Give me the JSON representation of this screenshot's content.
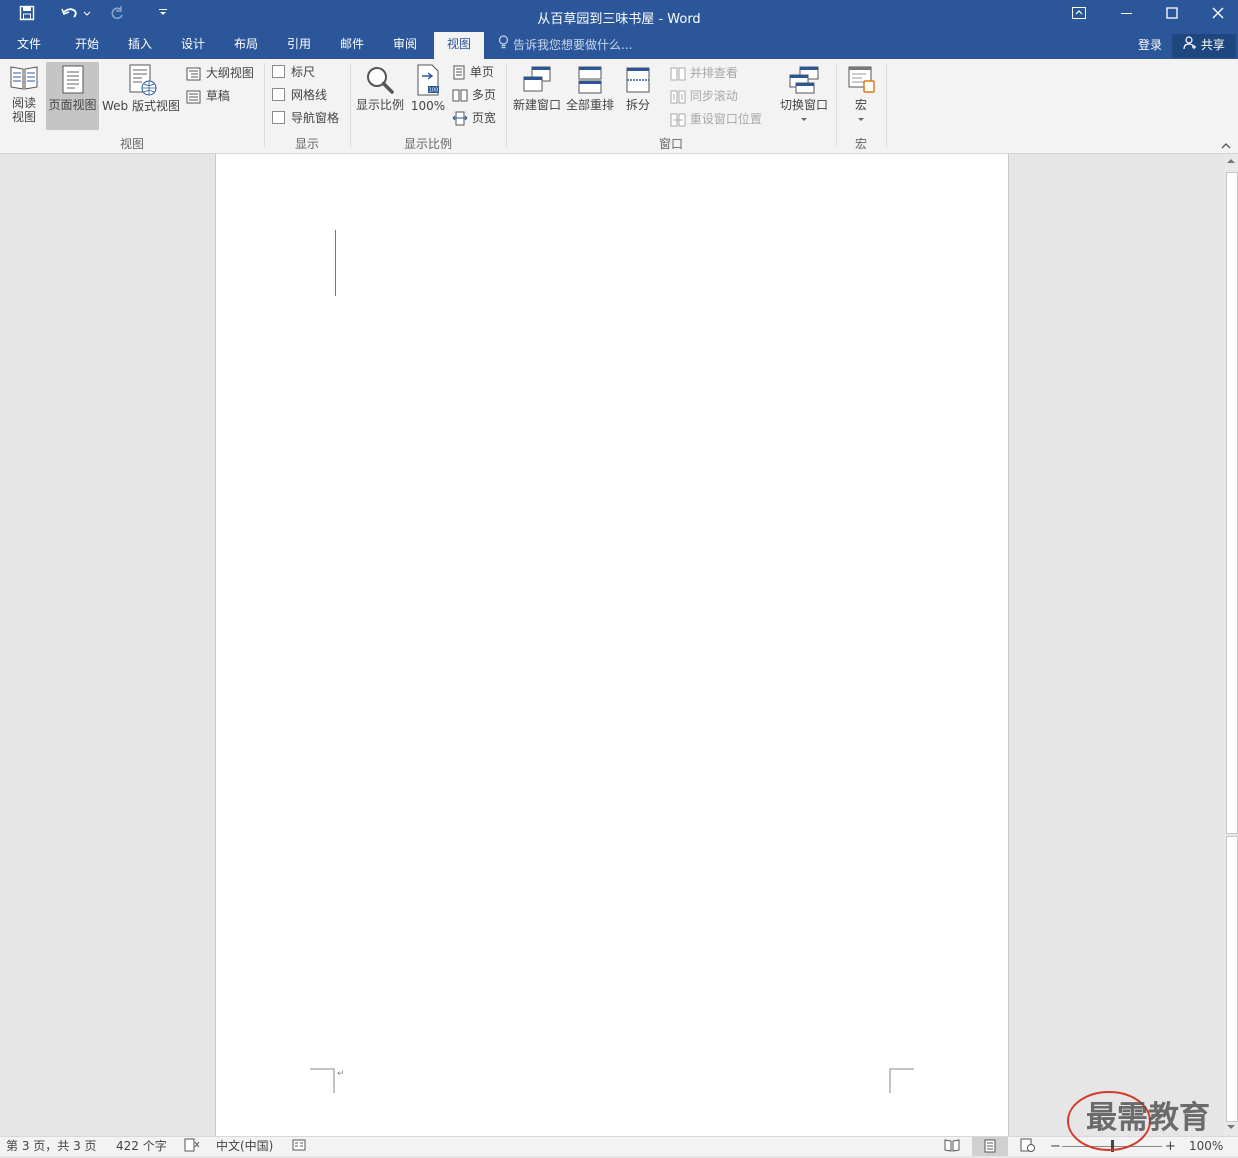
{
  "window": {
    "title": "从百草园到三味书屋 - Word"
  },
  "quick_access": {
    "save_icon": "save-icon",
    "undo_icon": "undo-icon",
    "redo_icon": "redo-icon",
    "customize_icon": "customize-qat-icon"
  },
  "tabs": [
    "文件",
    "开始",
    "插入",
    "设计",
    "布局",
    "引用",
    "邮件",
    "审阅",
    "视图"
  ],
  "active_tab": "视图",
  "tell_me": {
    "placeholder": "告诉我您想要做什么..."
  },
  "account": {
    "login": "登录",
    "share": "共享"
  },
  "ribbon": {
    "views": {
      "label": "视图",
      "read_mode": [
        "阅读",
        "视图"
      ],
      "print_layout": "页面视图",
      "web_layout": "Web 版式视图",
      "outline": "大纲视图",
      "draft": "草稿"
    },
    "show": {
      "label": "显示",
      "ruler": "标尺",
      "gridlines": "网格线",
      "nav_pane": "导航窗格"
    },
    "zoom": {
      "label": "显示比例",
      "zoom": "显示比例",
      "hundred": "100%",
      "one_page": "单页",
      "multi_page": "多页",
      "page_width": "页宽"
    },
    "window": {
      "label": "窗口",
      "new_window": "新建窗口",
      "arrange_all": "全部重排",
      "split": "拆分",
      "side_by_side": "并排查看",
      "sync_scroll": "同步滚动",
      "reset_position": "重设窗口位置",
      "switch_windows": "切换窗口"
    },
    "macros": {
      "label": "宏",
      "macros": "宏"
    }
  },
  "statusbar": {
    "page": "第 3 页，共 3 页",
    "words": "422 个字",
    "language": "中文(中国)",
    "zoom": "100%",
    "zoom_level_percent": 100
  },
  "watermark": {
    "text": "最需教育"
  }
}
